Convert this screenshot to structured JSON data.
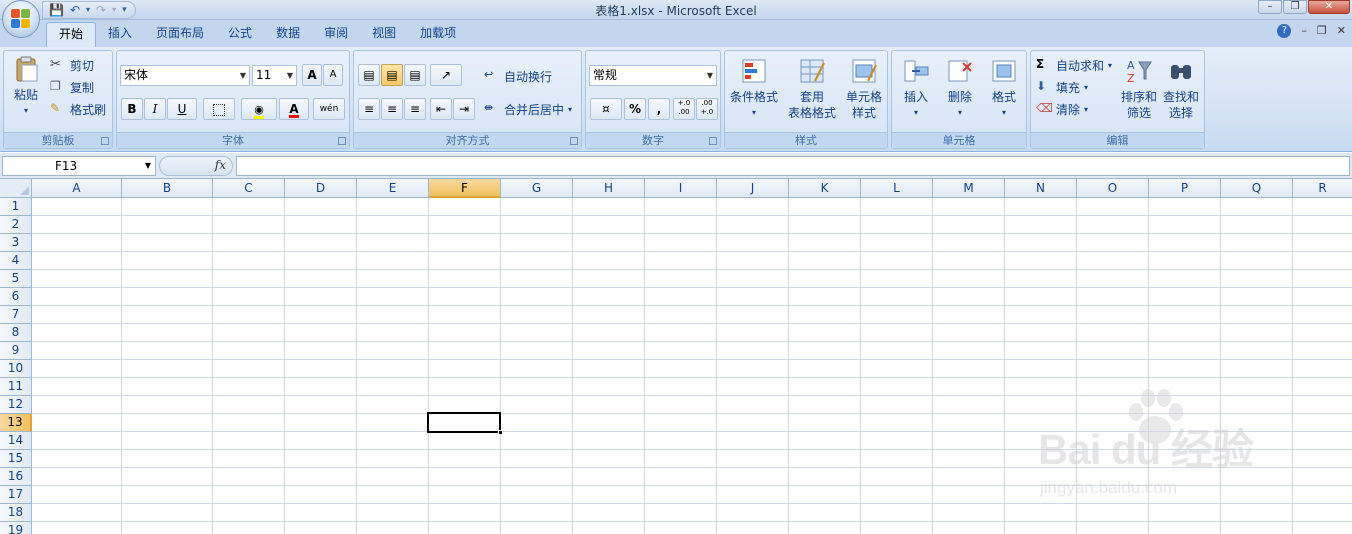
{
  "title_bar": {
    "title": "表格1.xlsx - Microsoft Excel"
  },
  "tabs": [
    "开始",
    "插入",
    "页面布局",
    "公式",
    "数据",
    "审阅",
    "视图",
    "加载项"
  ],
  "active_tab": "开始",
  "ribbon": {
    "clipboard": {
      "title": "剪贴板",
      "paste": "粘贴",
      "cut": "剪切",
      "copy": "复制",
      "format_painter": "格式刷"
    },
    "font": {
      "title": "字体",
      "font_name": "宋体",
      "font_size": "11",
      "grow": "A",
      "shrink": "A",
      "bold": "B",
      "italic": "I",
      "underline": "U",
      "phonetic": "wén"
    },
    "alignment": {
      "title": "对齐方式",
      "wrap_text": "自动换行",
      "merge_center": "合并后居中"
    },
    "number": {
      "title": "数字",
      "format": "常规",
      "percent": "%",
      "comma": ",",
      "inc_decimal": "+.0 .00",
      "dec_decimal": ".00 +.0"
    },
    "styles": {
      "title": "样式",
      "conditional": "条件格式",
      "table_line1": "套用",
      "table_line2": "表格格式",
      "cell_line1": "单元格",
      "cell_line2": "样式"
    },
    "cells": {
      "title": "单元格",
      "insert": "插入",
      "delete": "删除",
      "format": "格式"
    },
    "editing": {
      "title": "编辑",
      "autosum": "自动求和",
      "fill": "填充",
      "clear": "清除",
      "sort_line1": "排序和",
      "sort_line2": "筛选",
      "find_line1": "查找和",
      "find_line2": "选择"
    }
  },
  "formula_bar": {
    "name_box": "F13",
    "fx": "fx",
    "value": ""
  },
  "sheet": {
    "columns": [
      "A",
      "B",
      "C",
      "D",
      "E",
      "F",
      "G",
      "H",
      "I",
      "J",
      "K",
      "L",
      "M",
      "N",
      "O",
      "P",
      "Q",
      "R"
    ],
    "rows": [
      "1",
      "2",
      "3",
      "4",
      "5",
      "6",
      "7",
      "8",
      "9",
      "10",
      "11",
      "12",
      "13",
      "14",
      "15",
      "16",
      "17",
      "18",
      "19"
    ],
    "active_column": "F",
    "active_row": "13"
  },
  "watermark": {
    "main": "Bai  du 经验",
    "sub": "jingyan.baidu.com"
  },
  "colors": {
    "accent": "#15428b",
    "selection": "#f9d99f",
    "gridline": "#d0d7e5",
    "ribbon": "#dfe9f5"
  }
}
